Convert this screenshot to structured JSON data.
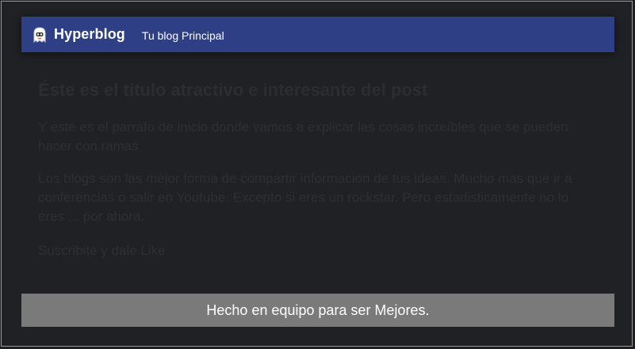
{
  "header": {
    "brand": "Hyperblog",
    "tagline": "Tu blog Principal",
    "logo_icon": "ghost-logo-icon",
    "bg_color": "#2f3f85"
  },
  "post": {
    "title": "Éste es el título atractivo e interesante del post",
    "lead": "Y este es el parrafo de inicio donde vamos a explicar las cosas increíbles que se pueden hacer con ramas",
    "body": "Los blogs son las mejor forma de compartir informacion de tus ideas. Mucho mas que ir a conferencias o salir en Youtube. Excepto si eres un rockstar. Pero estadisticamente no lo eres ... por ahora.",
    "cta": "Suscribite y dale Like"
  },
  "footer": {
    "text": "Hecho en equipo para ser Mejores.",
    "bg_color": "#7a7a7a"
  }
}
